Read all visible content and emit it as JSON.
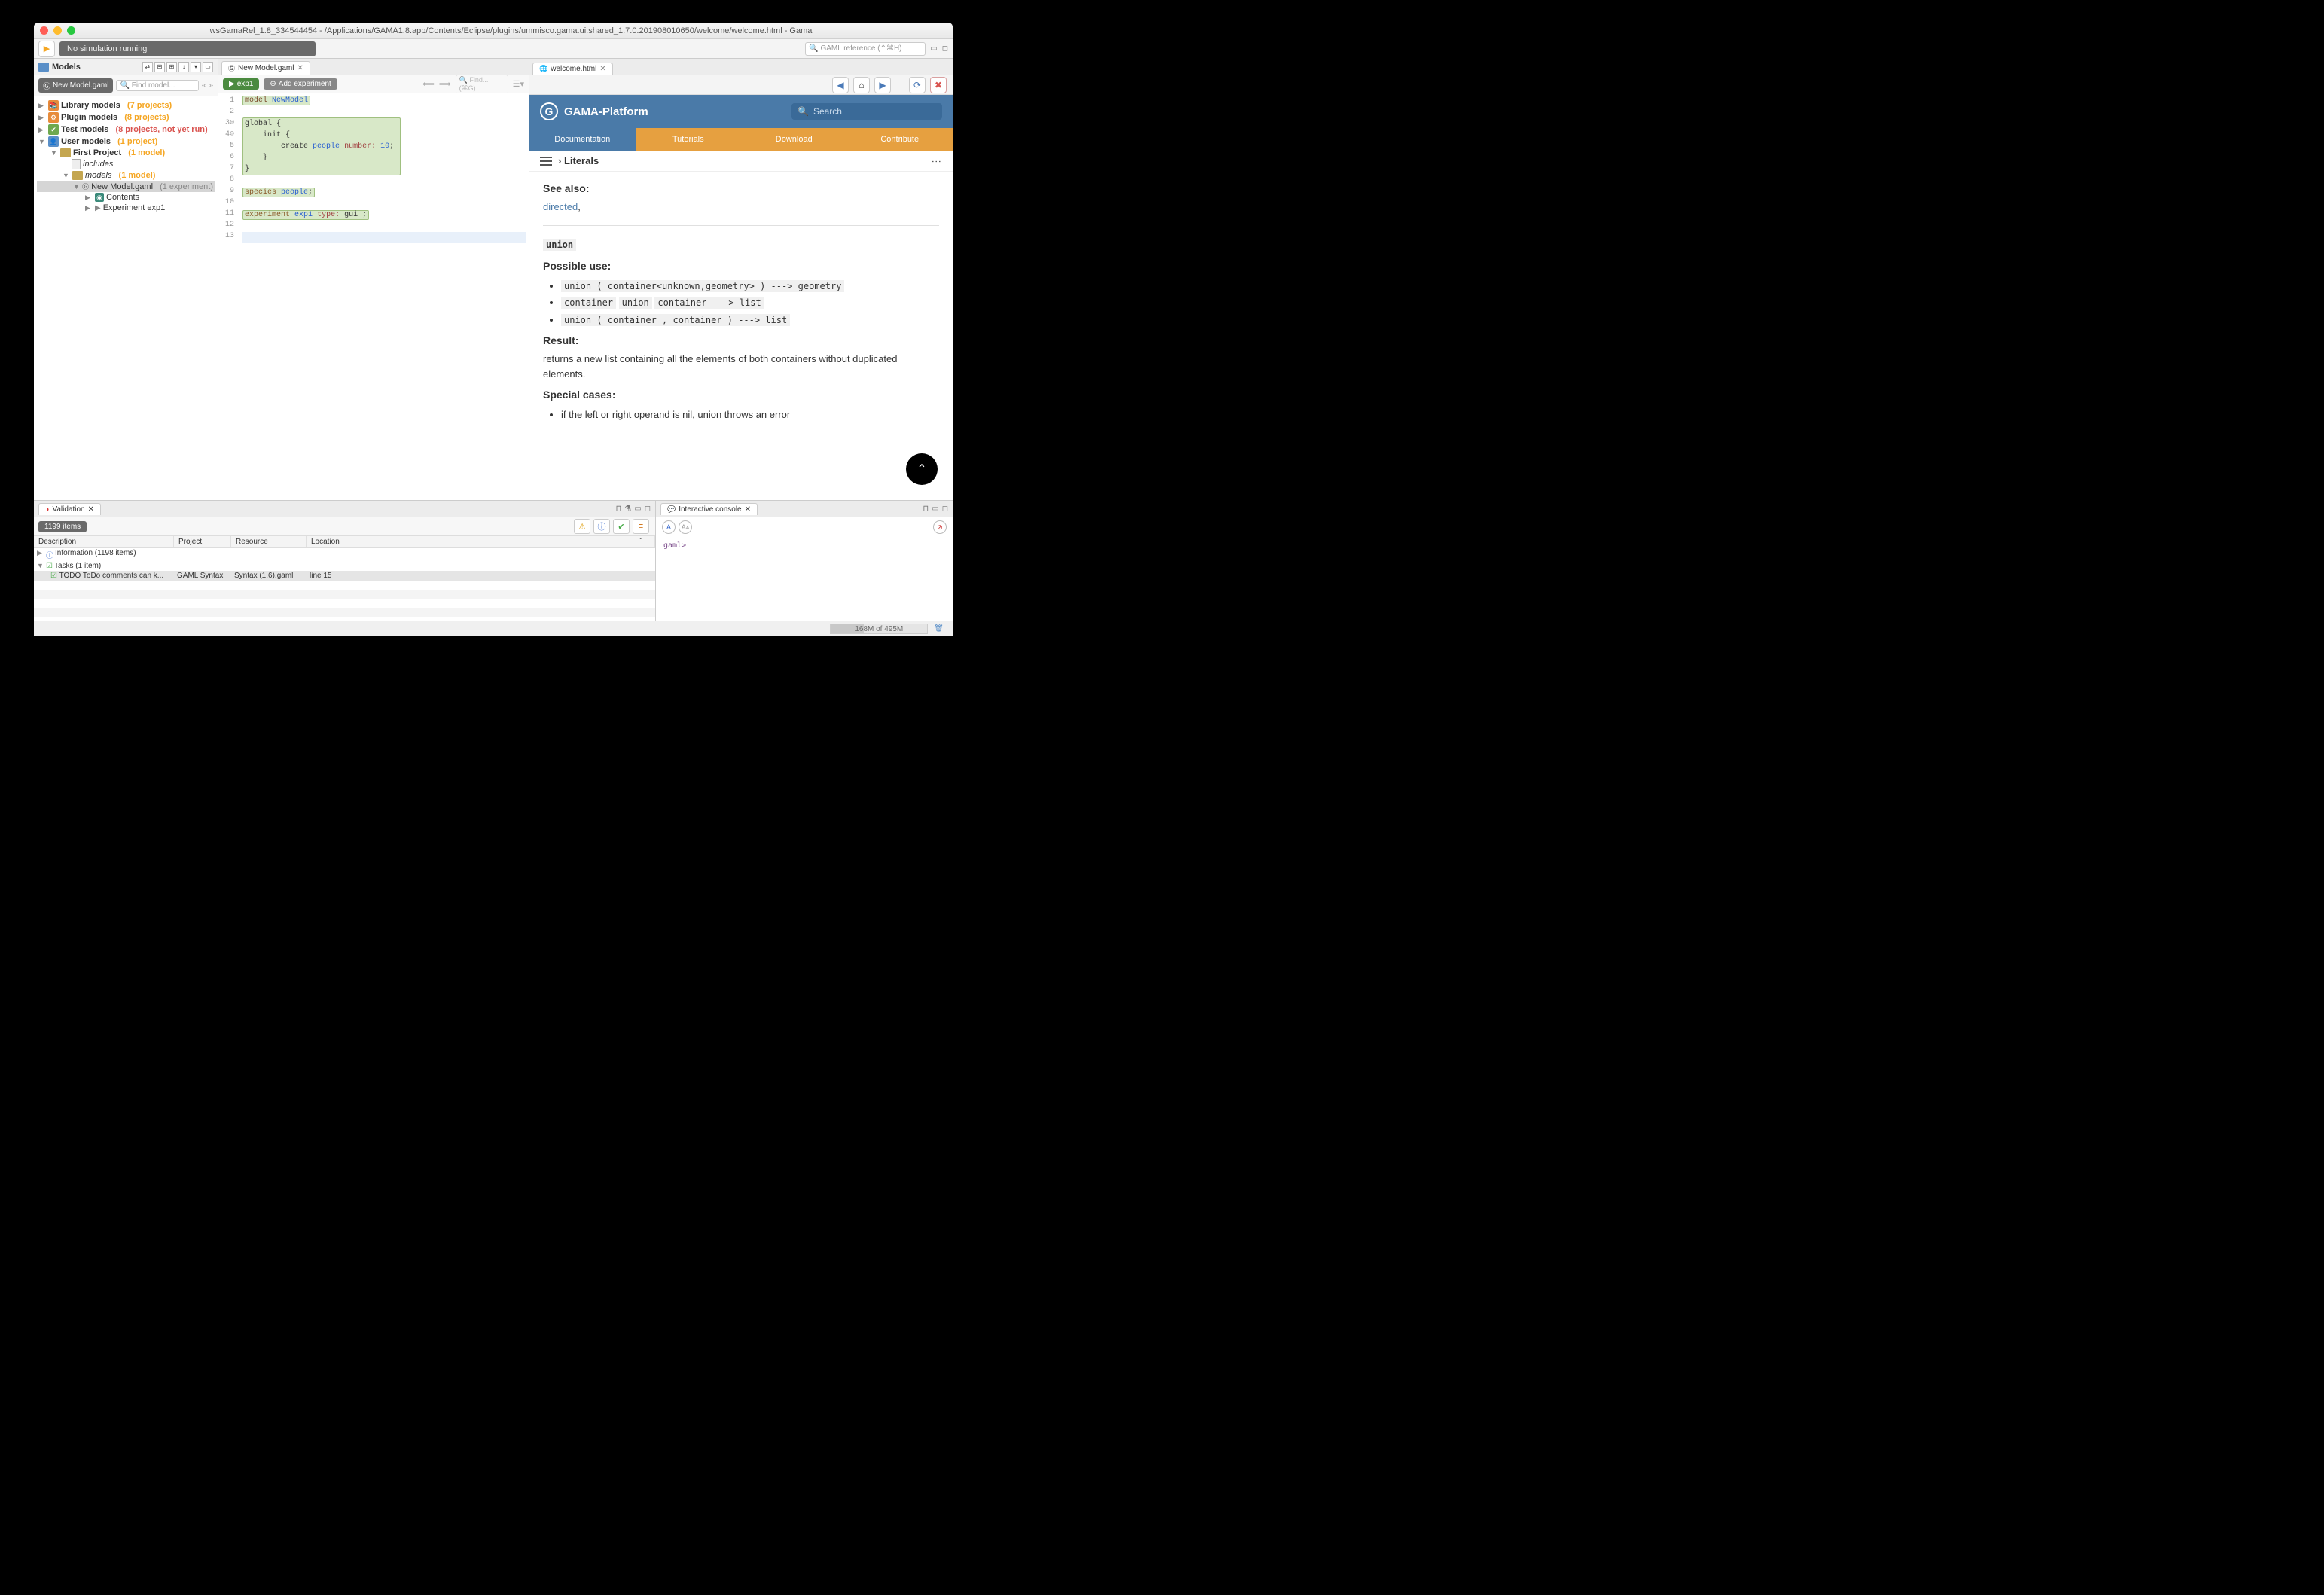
{
  "window": {
    "title": "wsGamaRel_1.8_334544454 - /Applications/GAMA1.8.app/Contents/Eclipse/plugins/ummisco.gama.ui.shared_1.7.0.201908010650/welcome/welcome.html - Gama"
  },
  "toolbar": {
    "sim_status": "No simulation running",
    "search_placeholder": "🔍 GAML reference (⌃⌘H)"
  },
  "models_view": {
    "title": "Models",
    "chip": "New Model.gaml",
    "find_placeholder": "🔍 Find model...",
    "tree": {
      "library": {
        "label": "Library models",
        "count": "(7 projects)"
      },
      "plugin": {
        "label": "Plugin models",
        "count": "(8 projects)"
      },
      "test": {
        "label": "Test models",
        "count": "(8 projects, not yet run)"
      },
      "user": {
        "label": "User models",
        "count": "(1 project)"
      },
      "first_project": {
        "label": "First Project",
        "count": "(1 model)"
      },
      "includes": "includes",
      "models_folder": {
        "label": "models",
        "count": "(1 model)"
      },
      "model_file": {
        "label": "New Model.gaml",
        "count": "(1 experiment)"
      },
      "contents": "Contents",
      "exp1": "Experiment exp1"
    }
  },
  "editor": {
    "tab": "New Model.gaml",
    "exp_btn": "exp1",
    "add_exp": "Add experiment",
    "find_placeholder": "🔍 Find... (⌘G)",
    "lines": [
      "1",
      "2",
      "3",
      "4",
      "5",
      "6",
      "7",
      "8",
      "9",
      "10",
      "11",
      "12",
      "13"
    ],
    "code": {
      "l1a": "model",
      "l1b": "NewModel",
      "l3": "global {",
      "l4": "    init {",
      "l5a": "        create",
      "l5b": "people",
      "l5c": "number:",
      "l5d": "10",
      "l5e": ";",
      "l6": "    }",
      "l7": "}",
      "l9a": "species",
      "l9b": "people",
      "l9c": ";",
      "l11a": "experiment",
      "l11b": "exp1",
      "l11c": "type:",
      "l11d": "gui",
      "l11e": " ;"
    }
  },
  "welcome": {
    "tab": "welcome.html",
    "header": "GAMA-Platform",
    "search_placeholder": "Search",
    "nav": {
      "doc": "Documentation",
      "tut": "Tutorials",
      "dl": "Download",
      "contrib": "Contribute"
    },
    "breadcrumb": "› Literals",
    "see_also": "See also:",
    "link_directed": "directed",
    "union_title": "union",
    "possible_use": "Possible use:",
    "use1": "union ( container<unknown,geometry> ) ---> geometry",
    "use2a": "container",
    "use2b": "union",
    "use2c": "container ---> list",
    "use3": "union ( container , container ) ---> list",
    "result_h": "Result:",
    "result_body": "returns a new list containing all the elements of both containers without duplicated elements.",
    "special_h": "Special cases:",
    "special_1": "if the left or right operand is nil, union throws an error"
  },
  "validation": {
    "tab": "Validation",
    "items": "1199 items",
    "headers": {
      "desc": "Description",
      "proj": "Project",
      "res": "Resource",
      "loc": "Location"
    },
    "info_row": "Information (1198 items)",
    "tasks_row": "Tasks (1 item)",
    "todo": {
      "desc": "TODO ToDo comments can k...",
      "proj": "GAML Syntax",
      "res": "Syntax (1.6).gaml",
      "loc": "line 15"
    }
  },
  "console": {
    "tab": "Interactive console",
    "prompt": "gaml>"
  },
  "statusbar": {
    "memory": "168M of 495M"
  }
}
